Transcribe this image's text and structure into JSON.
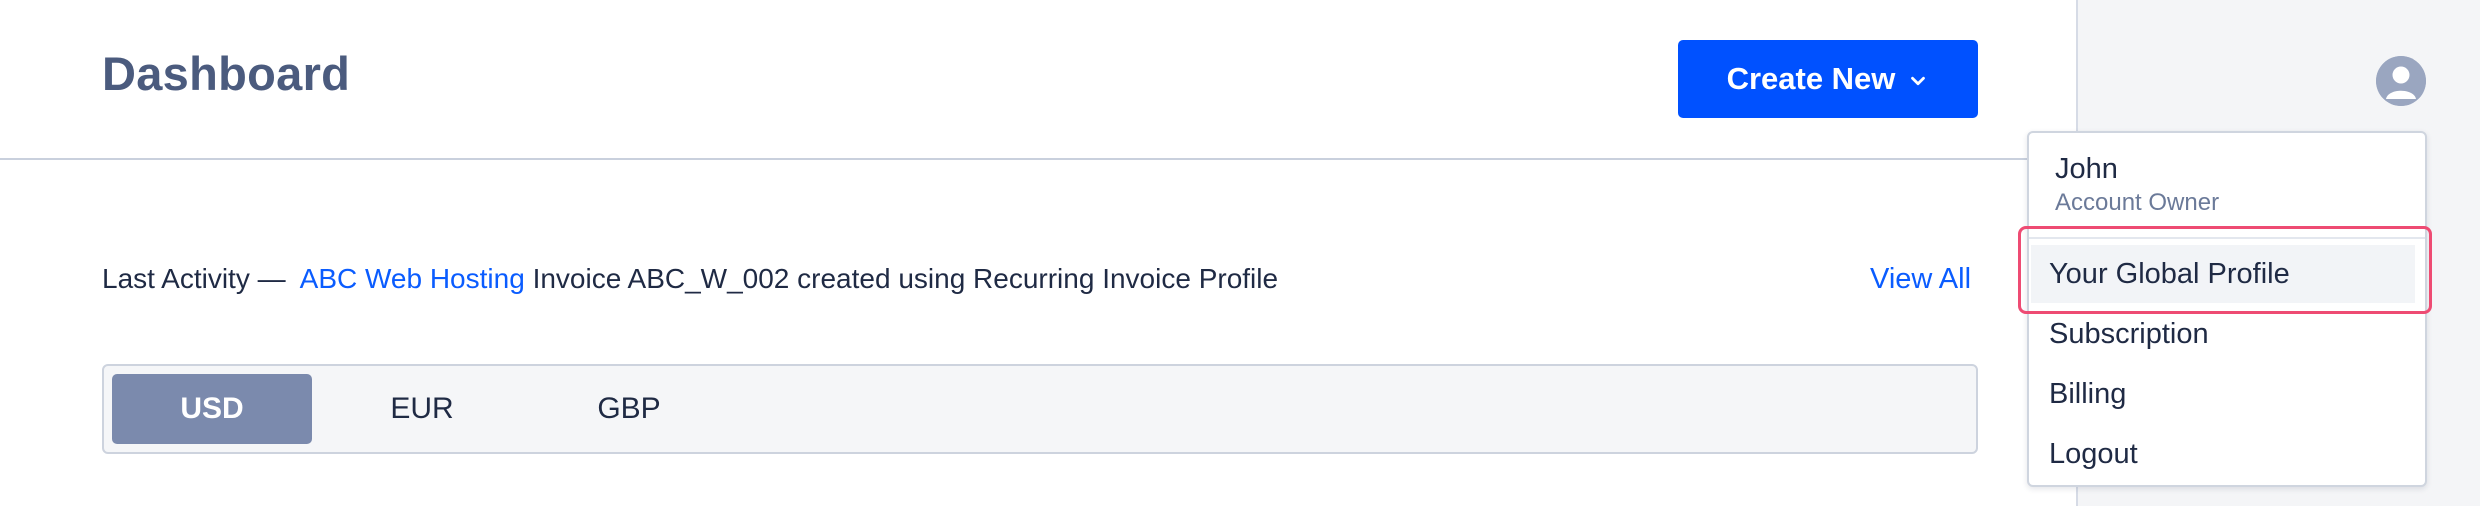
{
  "header": {
    "title": "Dashboard",
    "create_button_label": "Create New"
  },
  "activity": {
    "prefix": "Last Activity —",
    "link_text": "ABC Web Hosting",
    "message": "Invoice ABC_W_002 created using Recurring Invoice Profile",
    "view_all_label": "View All"
  },
  "currency_tabs": {
    "items": [
      {
        "label": "USD",
        "active": true
      },
      {
        "label": "EUR",
        "active": false
      },
      {
        "label": "GBP",
        "active": false
      }
    ]
  },
  "user_menu": {
    "name": "John",
    "role": "Account Owner",
    "items": [
      {
        "label": "Your Global Profile",
        "hovered": true
      },
      {
        "label": "Subscription"
      },
      {
        "label": "Billing"
      },
      {
        "label": "Logout"
      }
    ]
  },
  "colors": {
    "primary": "#0051ff",
    "link": "#0a5cff",
    "active_tab": "#7b8aad",
    "highlight": "#ee4b73"
  }
}
